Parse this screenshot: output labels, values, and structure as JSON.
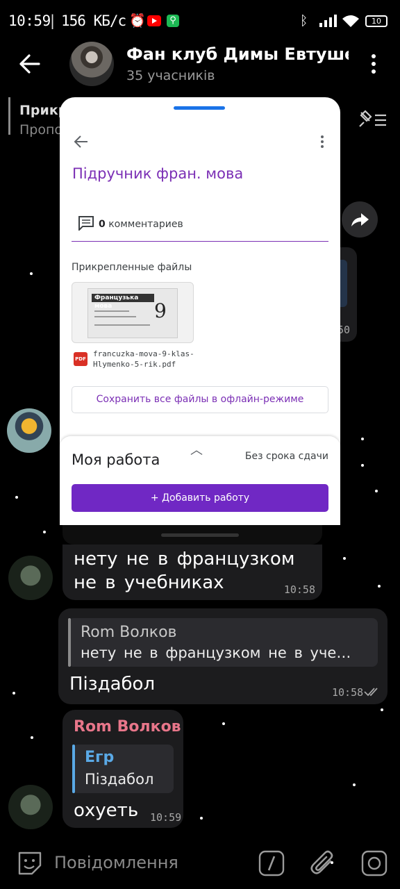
{
  "status_bar": {
    "time": "10:59",
    "speed": "156 КБ/с",
    "battery": "10",
    "icons": [
      "alarm-icon",
      "youtube-icon",
      "walk-icon",
      "bluetooth-icon",
      "signal-icon",
      "wifi-icon",
      "battery-icon"
    ]
  },
  "header": {
    "title": "Фан клуб Димы Евтушенко",
    "subtitle": "35 учасників",
    "back_icon": "back-arrow-icon",
    "menu_icon": "more-vert-icon"
  },
  "pinned": {
    "title": "Прикр",
    "subtitle": "Пропо",
    "icon": "pin-list-icon"
  },
  "classroom_card": {
    "title": "Підручник фран. мова",
    "comments_count": "0",
    "comments_label": "комментариев",
    "attached_label": "Прикрепленные файлы",
    "file_name": "francuzka-mova-9-klas-Hlymenko-5-rik.pdf",
    "file_type": "PDF",
    "thumb_caption": "Французька мова",
    "thumb_grade": "9",
    "save_all": "Сохранить все файлы в офлайн-режиме",
    "my_work": "Моя работа",
    "due": "Без срока сдачи",
    "add_work": "Добавить работу"
  },
  "photo_message": {
    "time_fragment": "50"
  },
  "messages": [
    {
      "text": "нету не в французком не в учебниках",
      "time": "10:58"
    },
    {
      "quote_author": "Rom Волков",
      "quote_text": "нету не в французком не в уче…",
      "text": "Піздабол",
      "time": "10:58"
    },
    {
      "author": "Rom Волков",
      "quote_author": "Егр",
      "quote_text": "Піздабол",
      "text": "охуеть",
      "time": "10:59"
    }
  ],
  "input": {
    "placeholder": "Повідомлення"
  },
  "colors": {
    "accent_purple": "#7028c4",
    "author_pink": "#e8768a",
    "quote_blue": "#5aa9e6",
    "bubble": "#1c1c1e"
  }
}
